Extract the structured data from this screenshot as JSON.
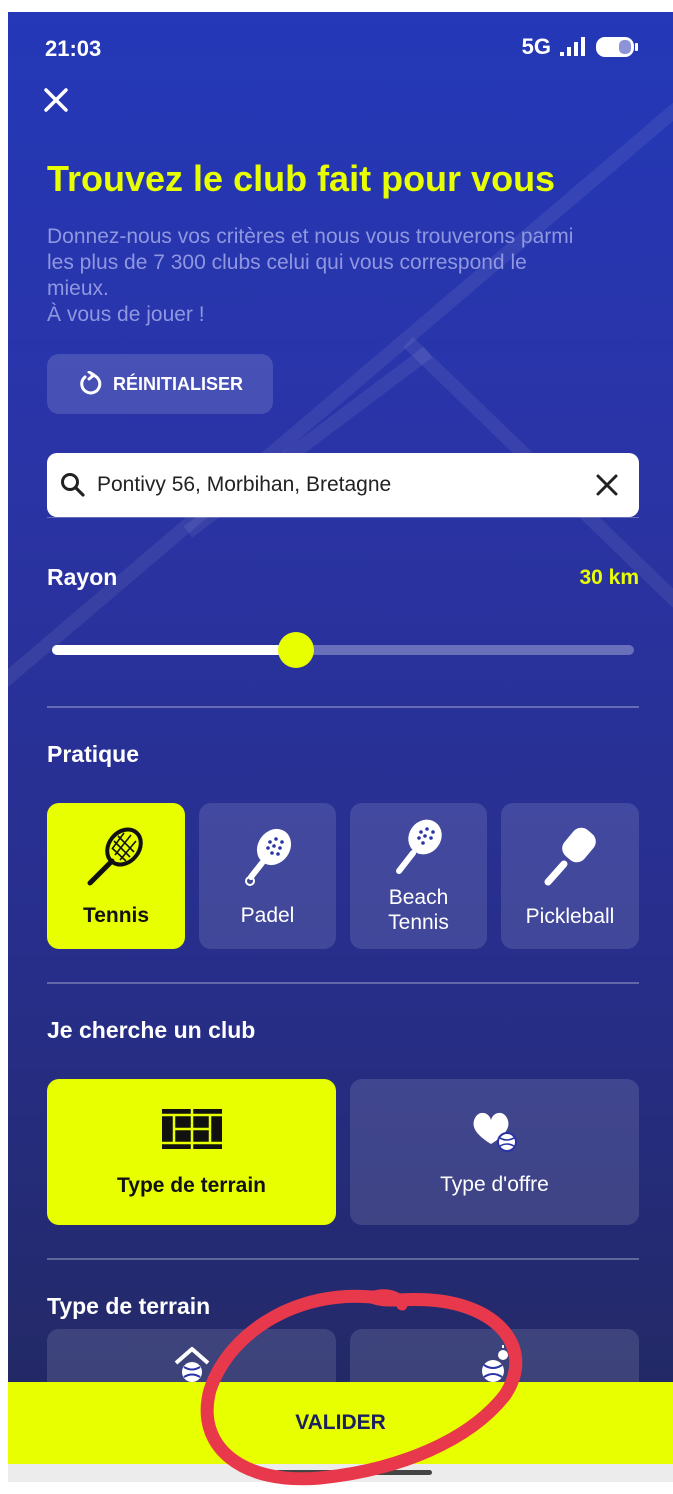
{
  "status_bar": {
    "time": "21:03",
    "network": "5G"
  },
  "header": {
    "title": "Trouvez le club fait pour vous",
    "subtitle_line1": "Donnez-nous vos critères et nous vous trouverons parmi",
    "subtitle_line2": "les plus de 7 300 clubs celui qui vous correspond le",
    "subtitle_line3": "mieux.",
    "subtitle_line4": "À vous de jouer !"
  },
  "reset_label": "RÉINITIALISER",
  "search": {
    "value": "Pontivy 56, Morbihan, Bretagne"
  },
  "radius": {
    "label": "Rayon",
    "value_text": "30 km",
    "fraction": 0.42
  },
  "practice": {
    "label": "Pratique",
    "items": [
      {
        "label": "Tennis",
        "icon": "tennis-racket-icon",
        "selected": true
      },
      {
        "label": "Padel",
        "icon": "padel-racket-icon",
        "selected": false
      },
      {
        "label": "Beach Tennis",
        "icon": "beach-tennis-racket-icon",
        "selected": false
      },
      {
        "label": "Pickleball",
        "icon": "pickleball-paddle-icon",
        "selected": false
      }
    ]
  },
  "club_search": {
    "label": "Je cherche un club",
    "items": [
      {
        "label": "Type de terrain",
        "icon": "court-icon",
        "selected": true
      },
      {
        "label": "Type d'offre",
        "icon": "heart-ball-icon",
        "selected": false
      }
    ]
  },
  "terrain_type": {
    "label": "Type de terrain",
    "items": [
      {
        "icon": "indoor-court-icon"
      },
      {
        "icon": "outdoor-court-icon"
      }
    ]
  },
  "validate_label": "VALIDER",
  "colors": {
    "accent": "#e8ff00",
    "background": "#2a34a6",
    "annotation": "#e8384c"
  }
}
